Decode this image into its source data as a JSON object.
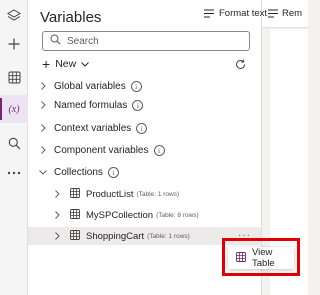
{
  "rail": {
    "icons": [
      "layers-icon",
      "plus-icon",
      "grid-icon",
      "variables-icon",
      "search-icon",
      "more-icon"
    ],
    "active_label": "(x)"
  },
  "panel": {
    "title": "Variables",
    "search_placeholder": "Search",
    "new_label": "New",
    "sections": [
      {
        "label": "Global variables",
        "info": "i"
      },
      {
        "label": "Named formulas",
        "info": "i"
      },
      {
        "label": "Context variables",
        "info": "i"
      },
      {
        "label": "Component variables",
        "info": "i"
      },
      {
        "label": "Collections",
        "info": "i"
      }
    ],
    "collections": [
      {
        "name": "ProductList",
        "meta": "(Table: 1 rows)"
      },
      {
        "name": "MySPCollection",
        "meta": "(Table: 8 rows)"
      },
      {
        "name": "ShoppingCart",
        "meta": "(Table: 1 rows)"
      }
    ],
    "more_label": "···"
  },
  "context_menu": {
    "view_table_label": "View Table"
  },
  "toolbar": {
    "format_text_label": "Format text",
    "remove_label": "Rem"
  },
  "colors": {
    "accent": "#742774",
    "highlight": "#e00000"
  }
}
